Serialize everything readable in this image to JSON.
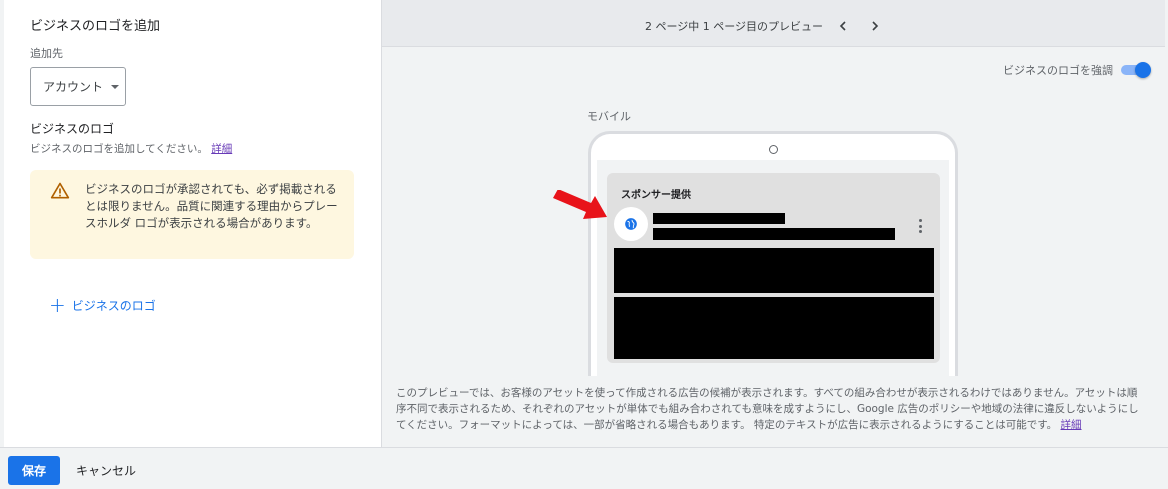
{
  "left_panel": {
    "title": "ビジネスのロゴを追加",
    "destination_label": "追加先",
    "destination_value": "アカウント",
    "logo_heading": "ビジネスのロゴ",
    "logo_subtext": "ビジネスのロゴを追加してください。",
    "details_link": "詳細",
    "warning_text": "ビジネスのロゴが承認されても、必ず掲載されるとは限りません。品質に関連する理由からプレースホルダ ロゴが表示される場合があります。",
    "add_logo_label": "ビジネスのロゴ"
  },
  "preview": {
    "pager_text": "2 ページ中 1 ページ目のプレビュー",
    "emphasize_label": "ビジネスのロゴを強調",
    "emphasize_on": true,
    "device_label": "モバイル",
    "sponsored_label": "スポンサー提供",
    "disclaimer": "このプレビューでは、お客様のアセットを使って作成される広告の候補が表示されます。すべての組み合わせが表示されるわけではありません。アセットは順序不同で表示されるため、それぞれのアセットが単体でも組み合わされても意味を成すようにし、Google 広告のポリシーや地域の法律に違反しないようにしてください。フォーマットによっては、一部が省略される場合もあります。 特定のテキストが広告に表示されるようにすることは可能です。",
    "disclaimer_link": "詳細"
  },
  "footer": {
    "save_label": "保存",
    "cancel_label": "キャンセル"
  },
  "colors": {
    "accent": "#1a73e8",
    "warning_bg": "#fef7e0",
    "link": "#673ab7",
    "arrow": "#e8131a"
  }
}
